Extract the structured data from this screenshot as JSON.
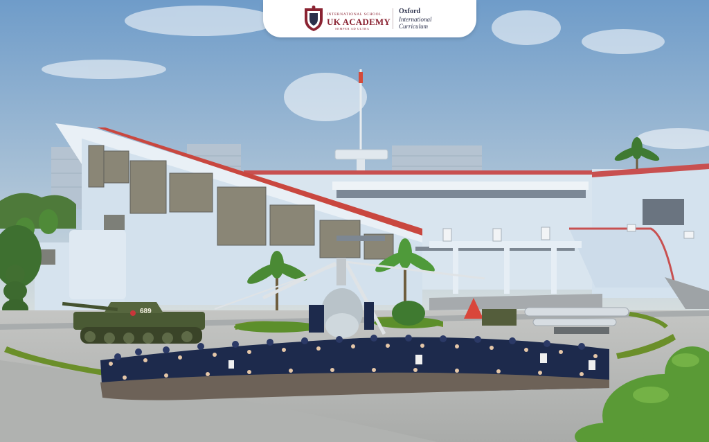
{
  "logo": {
    "school_top": "INTERNATIONAL SCHOOL",
    "school_name": "UK ACADEMY",
    "motto": "SEMPER AD ULTRA",
    "curriculum_line1": "Oxford",
    "curriculum_line2": "International",
    "curriculum_line3": "Curriculum"
  },
  "tank": {
    "number": "689"
  },
  "colors": {
    "brand": "#8a2332",
    "sky_top": "#6f9cc9",
    "sky_bottom": "#c7d7e2",
    "building": "#d7e4ef",
    "roof": "#c64b4b",
    "ground": "#b6b8b7",
    "uniform": "#1d2a4c",
    "hedge": "#6b8f2a"
  },
  "icons": [
    "school-crest-icon"
  ]
}
